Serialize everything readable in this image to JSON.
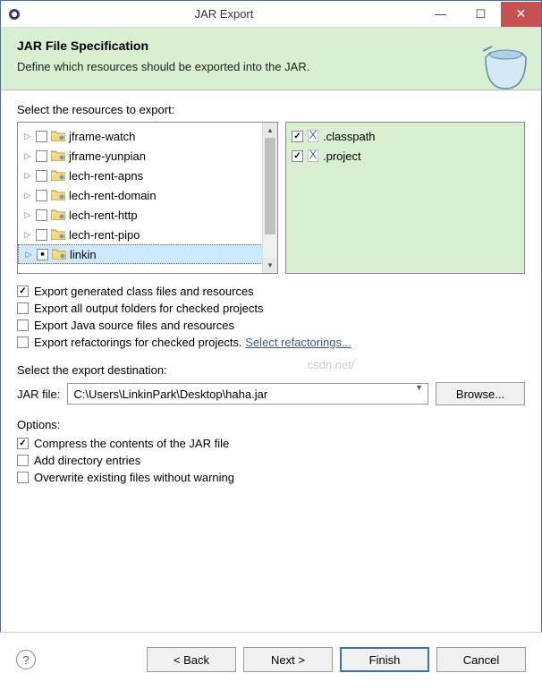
{
  "window": {
    "title": "JAR Export"
  },
  "header": {
    "title": "JAR File Specification",
    "subtitle": "Define which resources should be exported into the JAR."
  },
  "resources": {
    "label": "Select the resources to export:",
    "tree": [
      {
        "name": "jframe-watch",
        "state": ""
      },
      {
        "name": "jframe-yunpian",
        "state": ""
      },
      {
        "name": "lech-rent-apns",
        "state": ""
      },
      {
        "name": "lech-rent-domain",
        "state": ""
      },
      {
        "name": "lech-rent-http",
        "state": ""
      },
      {
        "name": "lech-rent-pipo",
        "state": ""
      },
      {
        "name": "linkin",
        "state": "partial",
        "selected": true
      }
    ],
    "files": [
      {
        "name": ".classpath",
        "checked": true
      },
      {
        "name": ".project",
        "checked": true
      }
    ]
  },
  "exportOptions": [
    {
      "label": "Export generated class files and resources",
      "checked": true
    },
    {
      "label": "Export all output folders for checked projects",
      "checked": false
    },
    {
      "label": "Export Java source files and resources",
      "checked": false
    },
    {
      "label": "Export refactorings for checked projects. ",
      "checked": false,
      "link": "Select refactorings..."
    }
  ],
  "destination": {
    "label": "Select the export destination:",
    "fieldLabel": "JAR file:",
    "value": "C:\\Users\\LinkinPark\\Desktop\\haha.jar",
    "browse": "Browse..."
  },
  "compressOptions": {
    "label": "Options:",
    "items": [
      {
        "label": "Compress the contents of the JAR file",
        "checked": true
      },
      {
        "label": "Add directory entries",
        "checked": false
      },
      {
        "label": "Overwrite existing files without warning",
        "checked": false
      }
    ]
  },
  "footer": {
    "back": "< Back",
    "next": "Next >",
    "finish": "Finish",
    "cancel": "Cancel"
  },
  "watermark": ".csdn.net/"
}
